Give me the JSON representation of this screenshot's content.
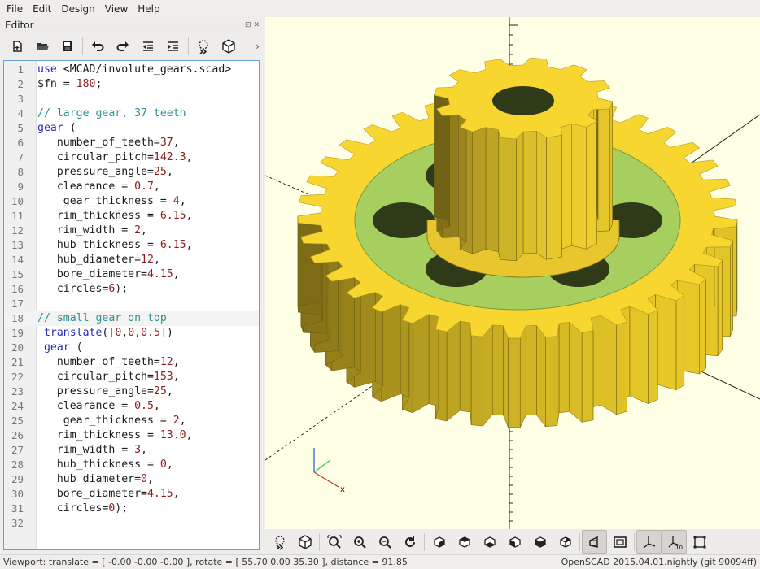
{
  "menu": [
    "File",
    "Edit",
    "Design",
    "View",
    "Help"
  ],
  "editor": {
    "title": "Editor",
    "more_indicator": "›",
    "toolbar_icons": [
      "new-file-icon",
      "open-file-icon",
      "save-icon",
      "undo-icon",
      "redo-icon",
      "unindent-icon",
      "indent-icon",
      "preview-icon",
      "render-icon"
    ],
    "lines": [
      "use <MCAD/involute_gears.scad>",
      "$fn = 180;",
      "",
      "// large gear, 37 teeth",
      "gear (",
      "   number_of_teeth=37,",
      "   circular_pitch=142.3,",
      "   pressure_angle=25,",
      "   clearance = 0.7,",
      "    gear_thickness = 4,",
      "   rim_thickness = 6.15,",
      "   rim_width = 2,",
      "   hub_thickness = 6.15,",
      "   hub_diameter=12,",
      "   bore_diameter=4.15,",
      "   circles=6);",
      "",
      "// small gear on top",
      " translate([0,0,0.5])",
      " gear (",
      "   number_of_teeth=12,",
      "   circular_pitch=153,",
      "   pressure_angle=25,",
      "   clearance = 0.5,",
      "    gear_thickness = 2,",
      "   rim_thickness = 13.0,",
      "   rim_width = 3,",
      "   hub_thickness = 0,",
      "   hub_diameter=0,",
      "   bore_diameter=4.15,",
      "   circles=0);",
      ""
    ],
    "current_line": 18
  },
  "viewport": {
    "axis_label": "x",
    "colors": {
      "background": "#ffffe5",
      "gear": "#f8d630",
      "gear_side": "#e3c42a",
      "hub": "#a7cf60"
    }
  },
  "view_toolbar_icons": [
    "preview-icon",
    "render-icon",
    "view-all-icon",
    "zoom-in-icon",
    "zoom-out-icon",
    "reset-view-icon",
    "view-right-icon",
    "view-top-icon",
    "view-bottom-icon",
    "view-left-icon",
    "view-front-icon",
    "view-back-icon",
    "perspective-icon",
    "orthogonal-icon",
    "show-axes-icon",
    "show-scale-icon",
    "show-edges-icon"
  ],
  "status": {
    "left": "Viewport: translate = [ -0.00 -0.00 -0.00 ], rotate = [ 55.70 0.00 35.30 ], distance = 91.85",
    "right": "OpenSCAD 2015.04.01.nightly (git 90094ff)"
  }
}
